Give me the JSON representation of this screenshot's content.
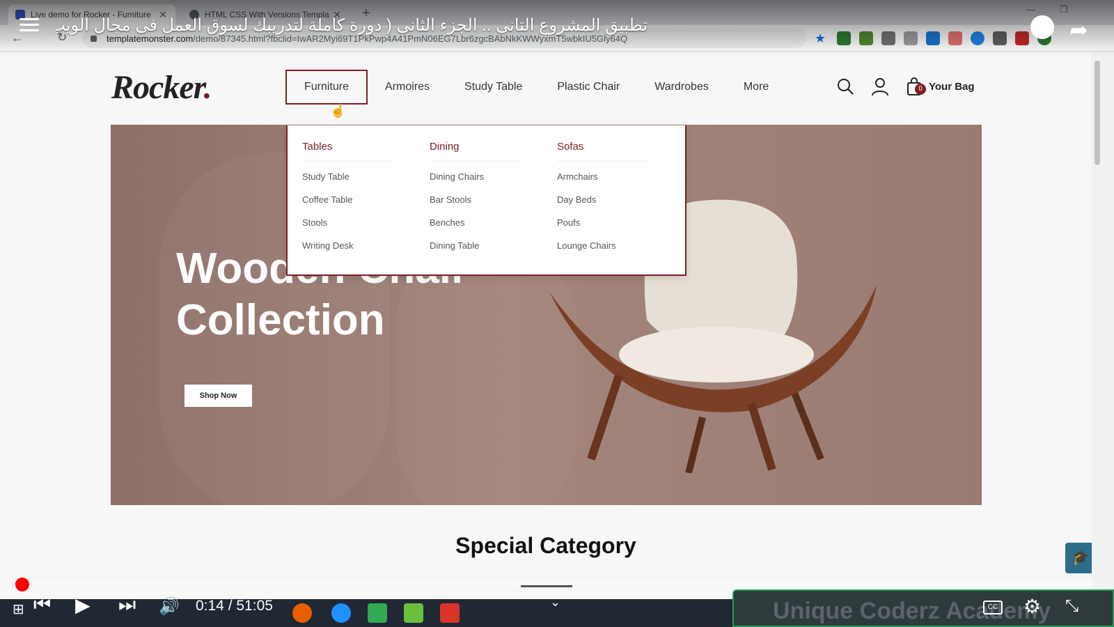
{
  "browser": {
    "tabs": [
      {
        "title": "Live demo for Rocker - Furniture",
        "active": true
      },
      {
        "title": "HTML CSS With Versions Templa",
        "active": false
      }
    ],
    "url_host": "templatemonster.com",
    "url_path": "/demo/87345.html?fbclid=IwAR2Myi69T1PkPwp4A41PmN06EG7Lbr6zgcBAbNkKWWyxmT5wbkIU5Gly64Q"
  },
  "video": {
    "title": "تطبيق المشروع التانى .. الجزء الثانى ( دورة كاملة لتدريبك لسوق العمل فى مجال الويب )",
    "time": "0:14 / 51:05",
    "progress": 0.0045,
    "channel_watermark": "Unique Coderz Academy",
    "cc_label": "CC"
  },
  "site": {
    "logo_text": "Rocker",
    "logo_dot": ".",
    "nav": [
      "Furniture",
      "Armoires",
      "Study Table",
      "Plastic Chair",
      "Wardrobes",
      "More"
    ],
    "active_nav": "Furniture",
    "bag_count": "0",
    "bag_label": "Your Bag",
    "mega_menu": [
      {
        "heading": "Tables",
        "items": [
          "Study Table",
          "Coffee Table",
          "Stools",
          "Writing Desk"
        ]
      },
      {
        "heading": "Dining",
        "items": [
          "Dining Chairs",
          "Bar Stools",
          "Benches",
          "Dining Table"
        ]
      },
      {
        "heading": "Sofas",
        "items": [
          "Armchairs",
          "Day Beds",
          "Poufs",
          "Lounge Chairs"
        ]
      }
    ],
    "hero": {
      "title_line1": "Wooden Chair",
      "title_line2": "Collection",
      "cta": "Shop Now"
    },
    "section_title": "Special Category"
  },
  "colors": {
    "accent": "#7a1f24",
    "hero_bg": "#9a7b73",
    "youtube_red": "#ff0000"
  }
}
